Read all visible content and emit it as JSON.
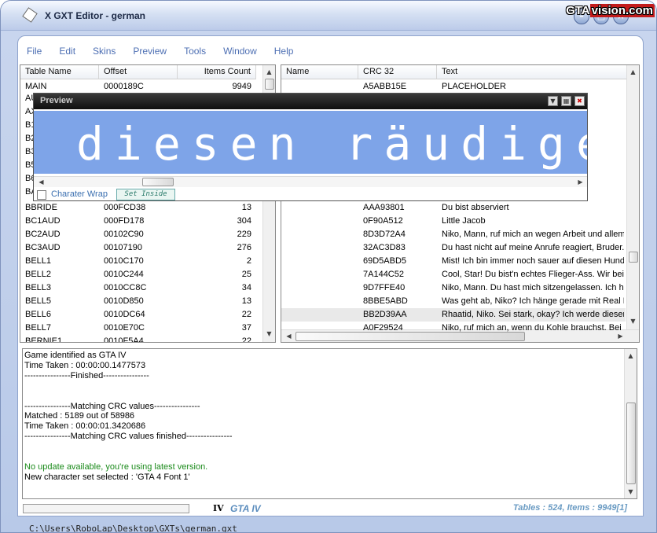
{
  "window": {
    "title": "X GXT Editor - german",
    "logo_left": "GTA",
    "logo_right": "vision.com"
  },
  "menu": [
    "File",
    "Edit",
    "Skins",
    "Preview",
    "Tools",
    "Window",
    "Help"
  ],
  "left_table": {
    "headers": [
      "Table Name",
      "Offset",
      "Items Count"
    ],
    "rows": [
      [
        "MAIN",
        "0000189C",
        "9949"
      ],
      [
        "BBRIDE",
        "000FCD38",
        "13"
      ],
      [
        "BC1AUD",
        "000FD178",
        "304"
      ],
      [
        "BC2AUD",
        "00102C90",
        "229"
      ],
      [
        "BC3AUD",
        "00107190",
        "276"
      ],
      [
        "BELL1",
        "0010C170",
        "2"
      ],
      [
        "BELL2",
        "0010C244",
        "25"
      ],
      [
        "BELL3",
        "0010CC8C",
        "34"
      ],
      [
        "BELL5",
        "0010D850",
        "13"
      ],
      [
        "BELL6",
        "0010DC64",
        "22"
      ],
      [
        "BELL7",
        "0010E70C",
        "37"
      ],
      [
        "BERNIE1",
        "0010F5A4",
        "22"
      ]
    ],
    "hidden_prefixes": [
      "AU",
      "AX",
      "B1",
      "B2",
      "B3",
      "B5",
      "B6",
      "BA"
    ]
  },
  "right_table": {
    "headers": [
      "Name",
      "CRC 32",
      "Text"
    ],
    "rows": [
      [
        "",
        "A5ABB15E",
        "PLACEHOLDER"
      ],
      [
        "",
        "AAA93801",
        "Du bist abserviert"
      ],
      [
        "",
        "0F90A512",
        "Little Jacob"
      ],
      [
        "",
        "8D3D72A4",
        "Niko, Mann, ruf mich an wegen Arbeit und allem."
      ],
      [
        "",
        "32AC3D83",
        "Du hast nicht auf meine Anrufe reagiert, Bruder. Ic"
      ],
      [
        "",
        "69D5ABD5",
        "Mist! Ich bin immer noch sauer auf diesen Hundes"
      ],
      [
        "",
        "7A144C52",
        "Cool, Star! Du bist'n echtes Flieger-Ass. Wir beide"
      ],
      [
        "",
        "9D7FFE40",
        "Niko, Mann. Du hast mich sitzengelassen. Ich hof"
      ],
      [
        "",
        "8BBE5ABD",
        "Was geht ab, Niko? Ich hänge gerade mit Real B"
      ],
      [
        "",
        "BB2D39AA",
        "Rhaatid, Niko. Sei stark, okay? Ich werde diesen"
      ],
      [
        "",
        "A0F29524",
        "Niko, ruf mich an, wenn du Kohle brauchst. Bei m"
      ]
    ]
  },
  "preview": {
    "title": "Preview",
    "text": "diesen räudige",
    "wrap_label": "Charater Wrap",
    "set_inside": "Set Inside"
  },
  "log": [
    {
      "text": "Game identified as GTA IV",
      "color": "#000000"
    },
    {
      "text": "Time Taken : 00:00:00.1477573",
      "color": "#000000"
    },
    {
      "text": "----------------Finished----------------",
      "color": "#000000"
    },
    {
      "text": "",
      "color": "#000000"
    },
    {
      "text": "",
      "color": "#000000"
    },
    {
      "text": "----------------Matching CRC values----------------",
      "color": "#000000"
    },
    {
      "text": "Matched : 5189 out of 58986",
      "color": "#000000"
    },
    {
      "text": "Time Taken : 00:00:01.3420686",
      "color": "#000000"
    },
    {
      "text": "----------------Matching CRC values finished----------------",
      "color": "#000000"
    },
    {
      "text": "",
      "color": "#000000"
    },
    {
      "text": "",
      "color": "#000000"
    },
    {
      "text": "No update available, you're using latest version.",
      "color": "#1a8a1a"
    },
    {
      "text": "New character set selected : 'GTA 4 Font 1'",
      "color": "#000000"
    }
  ],
  "status": {
    "iv_mark": "IV",
    "game": "GTA IV",
    "tables": "Tables : 524, Items : 9949[1]"
  },
  "path": "C:\\Users\\RoboLap\\Desktop\\GXTs\\german.gxt"
}
